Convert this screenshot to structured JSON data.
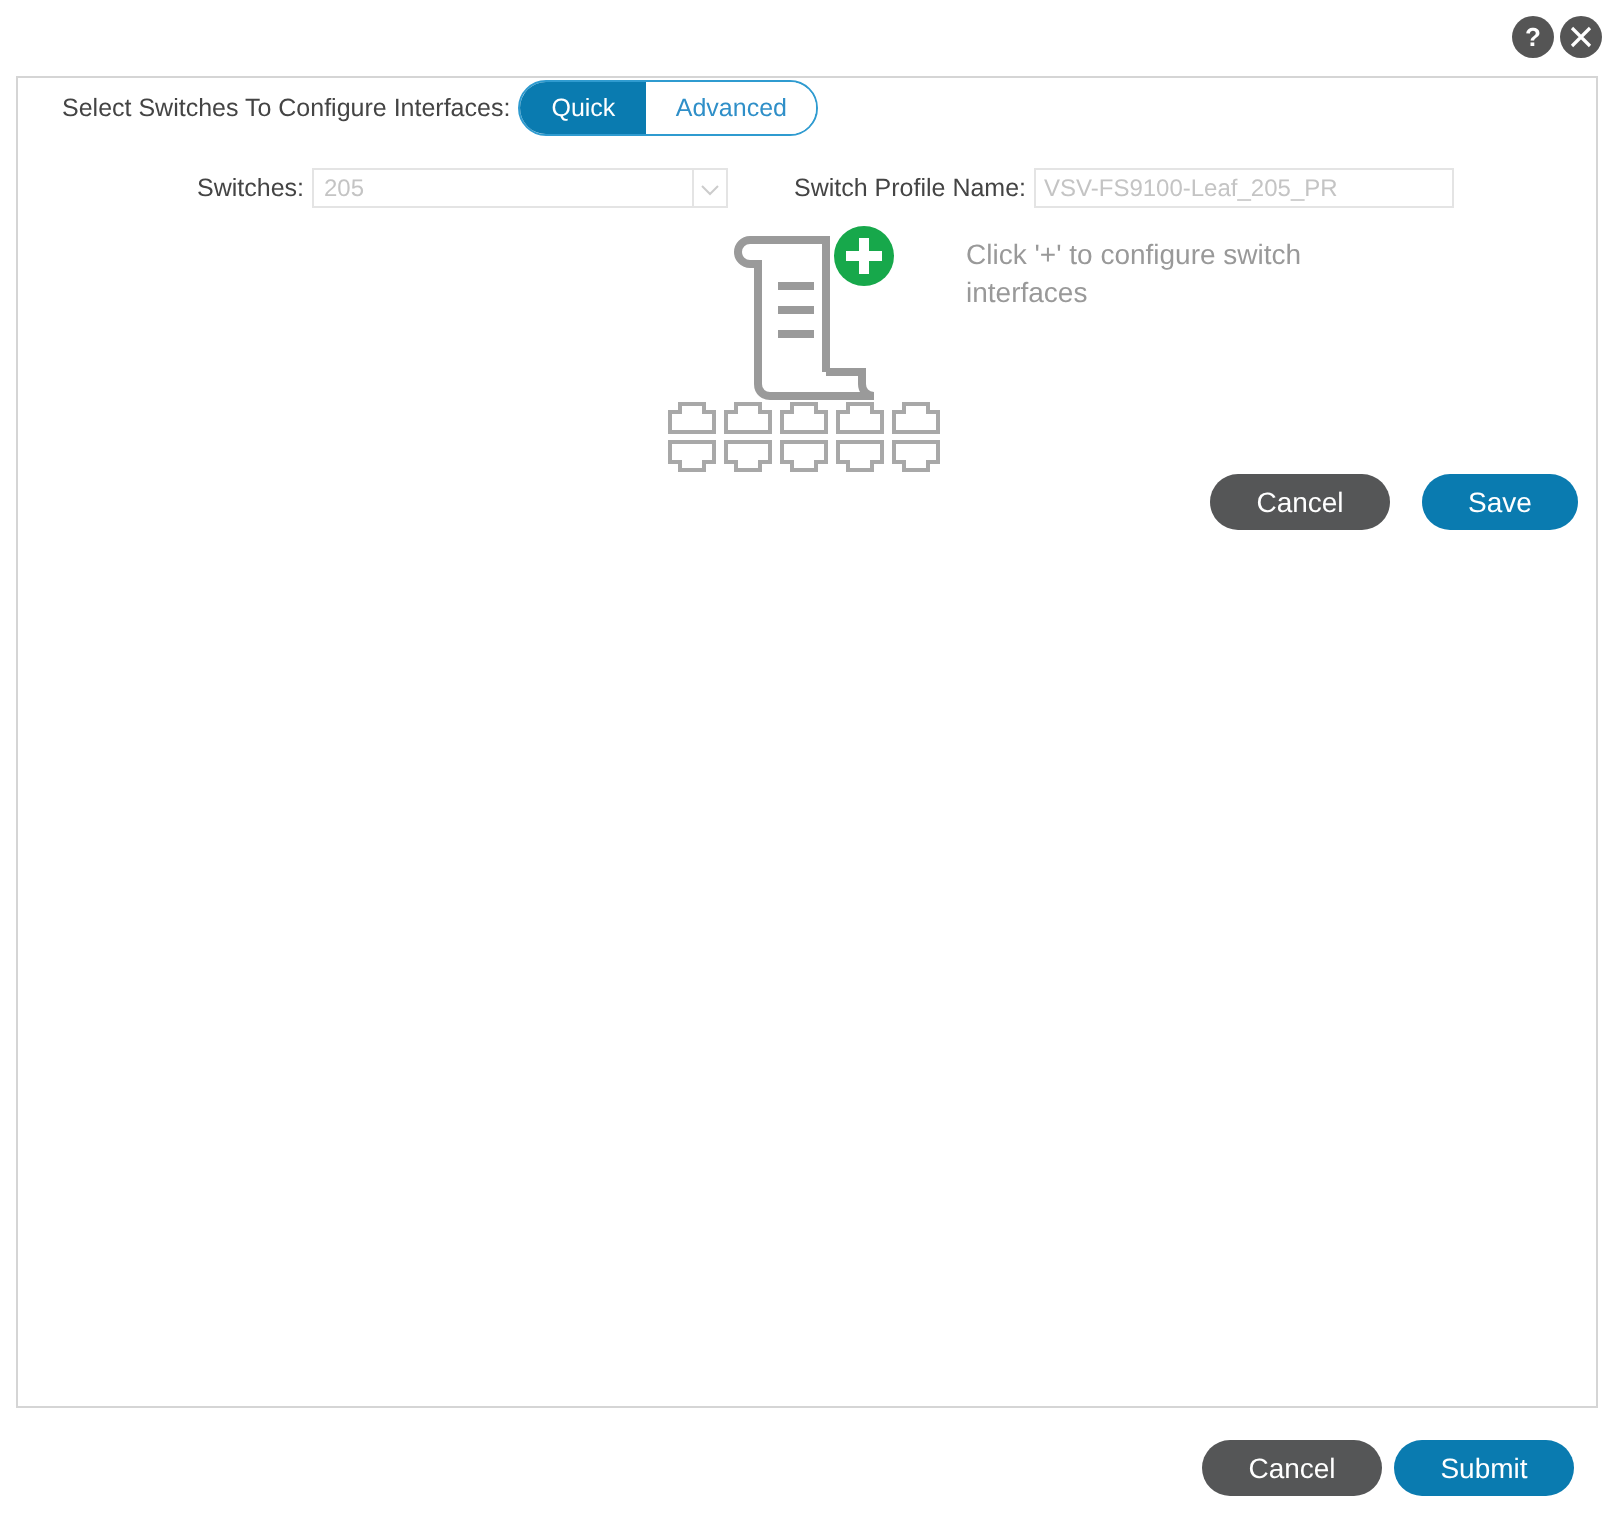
{
  "header_actions": [
    {
      "kind": "help",
      "label": "?"
    },
    {
      "kind": "close"
    }
  ],
  "mode_selector": {
    "label": "Select Switches To Configure Interfaces:",
    "options": [
      {
        "label": "Quick",
        "selected": true
      },
      {
        "label": "Advanced",
        "selected": false
      }
    ]
  },
  "switches": {
    "label": "Switches:",
    "value": "205",
    "disabled": true
  },
  "switch_profile_name": {
    "label": "Switch Profile Name:",
    "value": "VSV-FS9100-Leaf_205_PR",
    "disabled": true
  },
  "empty_state": {
    "message": "Click '+' to configure switch interfaces"
  },
  "panel_buttons": [
    {
      "label": "Cancel",
      "kind": "secondary"
    },
    {
      "label": "Save",
      "kind": "primary"
    }
  ],
  "footer_buttons": [
    {
      "label": "Cancel",
      "kind": "secondary"
    },
    {
      "label": "Submit",
      "kind": "primary"
    }
  ]
}
